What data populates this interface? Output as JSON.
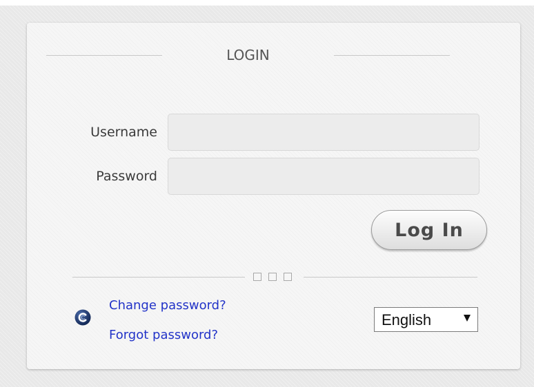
{
  "login": {
    "title": "LOGIN",
    "username_label": "Username",
    "username_value": "",
    "password_label": "Password",
    "password_value": "",
    "submit_label": "Log In"
  },
  "links": {
    "change_password": "Change password?",
    "forgot_password": "Forgot password?"
  },
  "language": {
    "selected": "English"
  },
  "icons": {
    "brand": "brand-logo-icon",
    "dropdown": "chevron-down-icon",
    "divider": "divider-squares-icon"
  },
  "colors": {
    "link": "#2233c8",
    "logo_fill": "#1a3366"
  }
}
